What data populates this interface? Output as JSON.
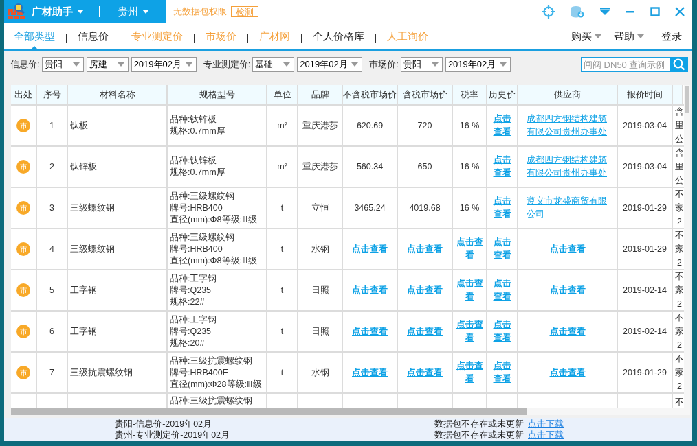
{
  "title_bar": {
    "app_menu": "广材助手",
    "region_menu": "贵州",
    "notice": "无数据包权限",
    "check_button": "检测"
  },
  "nav_tabs": [
    {
      "label": "全部类型",
      "selected": true,
      "color": "#1a9fe0"
    },
    {
      "label": "信息价",
      "selected": false,
      "color": "#222222"
    },
    {
      "label": "专业测定价",
      "selected": false,
      "color": "#f5a03a"
    },
    {
      "label": "市场价",
      "selected": false,
      "color": "#f5a03a"
    },
    {
      "label": "广材网",
      "selected": false,
      "color": "#f5a03a"
    },
    {
      "label": "个人价格库",
      "selected": false,
      "color": "#222222"
    },
    {
      "label": "人工询价",
      "selected": false,
      "color": "#f5a03a"
    }
  ],
  "nav_right": {
    "buy_menu": "购买",
    "help_menu": "帮助",
    "login": "登录"
  },
  "filters": [
    {
      "label": "信息价:",
      "dropdowns": [
        "贵阳",
        "房建",
        "2019年02月"
      ]
    },
    {
      "label": "专业测定价:",
      "dropdowns": [
        "基础",
        "2019年02月"
      ]
    },
    {
      "label": "市场价:",
      "dropdowns": [
        "贵阳",
        "2019年02月"
      ]
    }
  ],
  "search": {
    "placeholder": "闸阀 DN50 查询示例"
  },
  "table": {
    "columns": [
      "出处",
      "序号",
      "材料名称",
      "规格型号",
      "单位",
      "品牌",
      "不含税市场价",
      "含税市场价",
      "税率",
      "历史价",
      "供应商",
      "报价时间"
    ],
    "rows": [
      {
        "origin": "市",
        "no": "1",
        "name": "钛板",
        "spec": [
          "品种:钛锌板",
          "规格:0.7mm厚"
        ],
        "unit": "m²",
        "brand": "重庆港莎",
        "price_ex": {
          "text": "620.69",
          "link": false
        },
        "price_in": {
          "text": "720",
          "link": false
        },
        "tax": {
          "text": "16 %",
          "link": false
        },
        "history": {
          "text": "点击查看",
          "link": true
        },
        "supplier": {
          "text": "成都四方钢结构建筑有限公司贵州办事处",
          "link": true
        },
        "date": "2019-03-04",
        "column_13": [
          "含",
          "里",
          "公"
        ]
      },
      {
        "origin": "市",
        "no": "2",
        "name": "钛锌板",
        "spec": [
          "品种:钛锌板",
          "规格:0.7mm厚"
        ],
        "unit": "m²",
        "brand": "重庆港莎",
        "price_ex": {
          "text": "560.34",
          "link": false
        },
        "price_in": {
          "text": "650",
          "link": false
        },
        "tax": {
          "text": "16 %",
          "link": false
        },
        "history": {
          "text": "点击查看",
          "link": true
        },
        "supplier": {
          "text": "成都四方钢结构建筑有限公司贵州办事处",
          "link": true
        },
        "date": "2019-03-04",
        "column_13": [
          "含",
          "里",
          "公"
        ]
      },
      {
        "origin": "市",
        "no": "3",
        "name": "三级螺纹钢",
        "spec": [
          "品种:三级螺纹钢",
          "牌号:HRB400",
          "直径(mm):Φ8等级:Ⅲ级"
        ],
        "unit": "t",
        "brand": "立恒",
        "price_ex": {
          "text": "3465.24",
          "link": false
        },
        "price_in": {
          "text": "4019.68",
          "link": false
        },
        "tax": {
          "text": "16 %",
          "link": false
        },
        "history": {
          "text": "点击查看",
          "link": true
        },
        "supplier": {
          "text": "遵义市龙盛商贸有限公司",
          "link": true
        },
        "date": "2019-01-29",
        "column_13": [
          "不",
          "家",
          "2"
        ]
      },
      {
        "origin": "市",
        "no": "4",
        "name": "三级螺纹钢",
        "spec": [
          "品种:三级螺纹钢",
          "牌号:HRB400",
          "直径(mm):Φ8等级:Ⅲ级"
        ],
        "unit": "t",
        "brand": "水钢",
        "price_ex": {
          "text": "点击查看",
          "link": true
        },
        "price_in": {
          "text": "点击查看",
          "link": true
        },
        "tax": {
          "text": "点击查看",
          "link": true
        },
        "history": {
          "text": "点击查看",
          "link": true
        },
        "supplier": {
          "text": "点击查看",
          "link": true
        },
        "date": "2019-01-29",
        "column_13": [
          "不",
          "家",
          "2"
        ]
      },
      {
        "origin": "市",
        "no": "5",
        "name": "工字钢",
        "spec": [
          "品种:工字钢",
          "牌号:Q235",
          "规格:22#"
        ],
        "unit": "t",
        "brand": "日照",
        "price_ex": {
          "text": "点击查看",
          "link": true
        },
        "price_in": {
          "text": "点击查看",
          "link": true
        },
        "tax": {
          "text": "点击查看",
          "link": true
        },
        "history": {
          "text": "点击查看",
          "link": true
        },
        "supplier": {
          "text": "点击查看",
          "link": true
        },
        "date": "2019-02-14",
        "column_13": [
          "不",
          "家",
          "2"
        ]
      },
      {
        "origin": "市",
        "no": "6",
        "name": "工字钢",
        "spec": [
          "品种:工字钢",
          "牌号:Q235",
          "规格:20#"
        ],
        "unit": "t",
        "brand": "日照",
        "price_ex": {
          "text": "点击查看",
          "link": true
        },
        "price_in": {
          "text": "点击查看",
          "link": true
        },
        "tax": {
          "text": "点击查看",
          "link": true
        },
        "history": {
          "text": "点击查看",
          "link": true
        },
        "supplier": {
          "text": "点击查看",
          "link": true
        },
        "date": "2019-02-14",
        "column_13": [
          "不",
          "家",
          "2"
        ]
      },
      {
        "origin": "市",
        "no": "7",
        "name": "三级抗震螺纹钢",
        "spec": [
          "品种:三级抗震螺纹钢",
          "牌号:HRB400E",
          "直径(mm):Φ28等级:Ⅲ级"
        ],
        "unit": "t",
        "brand": "水钢",
        "price_ex": {
          "text": "点击查看",
          "link": true
        },
        "price_in": {
          "text": "点击查看",
          "link": true
        },
        "tax": {
          "text": "点击查看",
          "link": true
        },
        "history": {
          "text": "点击查看",
          "link": true
        },
        "supplier": {
          "text": "点击查看",
          "link": true
        },
        "date": "2019-01-29",
        "column_13": [
          "不",
          "家",
          "2"
        ]
      },
      {
        "spec": [
          "品种:三级抗震螺纹钢"
        ],
        "column_13": [
          "不"
        ]
      }
    ]
  },
  "status_bar": [
    {
      "package": "贵阳-信息价-2019年02月",
      "message": "数据包不存在或未更新",
      "link": "点击下载"
    },
    {
      "package": "贵州-专业测定价-2019年02月",
      "message": "数据包不存在或未更新",
      "link": "点击下载"
    }
  ]
}
